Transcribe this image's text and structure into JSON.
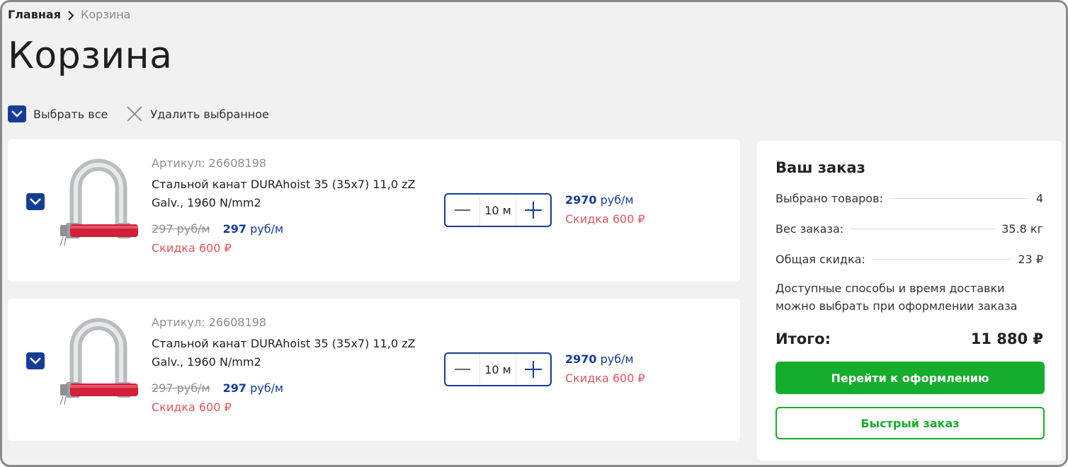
{
  "breadcrumb": {
    "home": "Главная",
    "current": "Корзина"
  },
  "page_title": "Корзина",
  "toolbar": {
    "select_all": "Выбрать все",
    "delete_selected": "Удалить выбранное"
  },
  "items": [
    {
      "sku": "Артикул: 26608198",
      "name": "Стальной канат DURAhoist 35 (35x7) 11,0 zZ Galv., 1960 N/mm2",
      "old_price": "297 руб/м",
      "price_value": "297",
      "price_unit": "руб/м",
      "discount": "Скидка 600 ₽",
      "quantity": "10 м",
      "total_value": "2970",
      "total_unit": "руб/м",
      "total_discount": "Скидка 600 ₽",
      "checked": true
    },
    {
      "sku": "Артикул: 26608198",
      "name": "Стальной канат DURAhoist 35 (35x7) 11,0 zZ Galv., 1960 N/mm2",
      "old_price": "297 руб/м",
      "price_value": "297",
      "price_unit": "руб/м",
      "discount": "Скидка 600 ₽",
      "quantity": "10 м",
      "total_value": "2970",
      "total_unit": "руб/м",
      "total_discount": "Скидка 600 ₽",
      "checked": true
    }
  ],
  "summary": {
    "title": "Ваш заказ",
    "rows": [
      {
        "label": "Выбрано товаров:",
        "value": "4"
      },
      {
        "label": "Вес заказа:",
        "value": "35.8 кг"
      },
      {
        "label": "Общая скидка:",
        "value": "23 ₽"
      }
    ],
    "note": "Доступные способы и время доставки можно выбрать при оформлении заказа",
    "total_label": "Итого:",
    "total_value": "11 880 ₽",
    "checkout_button": "Перейти к оформлению",
    "quick_order_button": "Быстрый заказ"
  },
  "colors": {
    "accent_blue": "#143d95",
    "discount_red": "#e0555a",
    "button_green": "#17ad2c",
    "muted_text": "#8f8f8f",
    "page_background": "#f1f1f1"
  },
  "icons": [
    "chevron-right-icon",
    "checkbox-checked-icon",
    "close-icon",
    "minus-icon",
    "plus-icon",
    "shackle-product-image"
  ]
}
